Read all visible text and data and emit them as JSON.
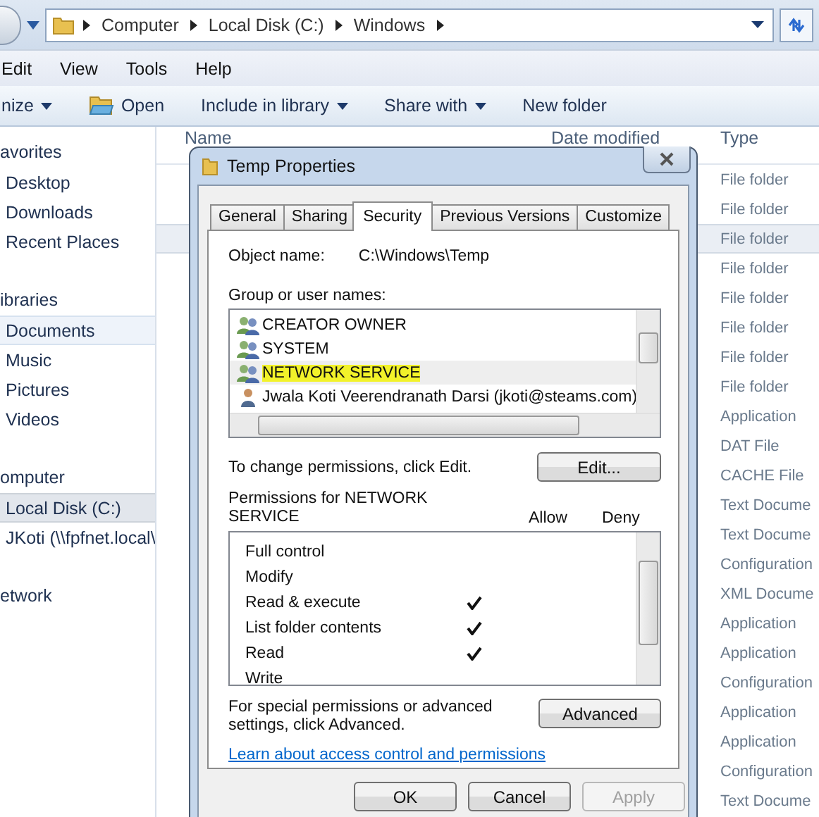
{
  "address_bar": {
    "path": [
      "Computer",
      "Local Disk (C:)",
      "Windows"
    ]
  },
  "menu": [
    "Edit",
    "View",
    "Tools",
    "Help"
  ],
  "toolbar": [
    {
      "label": "nize",
      "kind": "dropdown"
    },
    {
      "label": "Open",
      "kind": "icon"
    },
    {
      "label": "Include in library",
      "kind": "dropdown"
    },
    {
      "label": "Share with",
      "kind": "dropdown"
    },
    {
      "label": "New folder",
      "kind": "plain"
    }
  ],
  "nav": [
    {
      "label": "avorites",
      "items": [
        {
          "label": "Desktop",
          "selected": false,
          "hovered": false
        },
        {
          "label": "Downloads",
          "selected": false,
          "hovered": false
        },
        {
          "label": "Recent Places",
          "selected": false,
          "hovered": false
        }
      ]
    },
    {
      "label": "ibraries",
      "items": [
        {
          "label": "Documents",
          "selected": false,
          "hovered": true
        },
        {
          "label": "Music",
          "selected": false,
          "hovered": false
        },
        {
          "label": "Pictures",
          "selected": false,
          "hovered": false
        },
        {
          "label": "Videos",
          "selected": false,
          "hovered": false
        }
      ]
    },
    {
      "label": "omputer",
      "items": [
        {
          "label": "Local Disk (C:)",
          "selected": true,
          "hovered": false
        },
        {
          "label": "JKoti (\\\\fpfnet.local\\",
          "selected": false,
          "hovered": false
        }
      ]
    },
    {
      "label": "etwork"
    }
  ],
  "file_list": {
    "columns": [
      "Name",
      "Date modified",
      "Type"
    ],
    "rows": [
      {
        "type": "File folder",
        "selected": false
      },
      {
        "type": "File folder",
        "selected": false
      },
      {
        "type": "File folder",
        "selected": true
      },
      {
        "type": "File folder",
        "selected": false
      },
      {
        "type": "File folder",
        "selected": false
      },
      {
        "type": "File folder",
        "selected": false
      },
      {
        "type": "File folder",
        "selected": false
      },
      {
        "type": "File folder",
        "selected": false
      },
      {
        "type": "Application",
        "selected": false
      },
      {
        "type": "DAT File",
        "selected": false
      },
      {
        "type": "CACHE File",
        "selected": false
      },
      {
        "type": "Text Docume",
        "selected": false
      },
      {
        "type": "Text Docume",
        "selected": false
      },
      {
        "type": "Configuration",
        "selected": false
      },
      {
        "type": "XML Docume",
        "selected": false
      },
      {
        "type": "Application",
        "selected": false
      },
      {
        "type": "Application",
        "selected": false
      },
      {
        "type": "Configuration",
        "selected": false
      },
      {
        "type": "Application",
        "selected": false
      },
      {
        "type": "Application",
        "selected": false
      },
      {
        "type": "Configuration",
        "selected": false
      },
      {
        "type": "Text Docume",
        "selected": false
      }
    ]
  },
  "dialog": {
    "title": "Temp Properties",
    "tabs": [
      {
        "label": "General",
        "selected": false
      },
      {
        "label": "Sharing",
        "selected": false
      },
      {
        "label": "Security",
        "selected": true
      },
      {
        "label": "Previous Versions",
        "selected": false
      },
      {
        "label": "Customize",
        "selected": false
      }
    ],
    "object_name_label": "Object name:",
    "object_name": "C:\\Windows\\Temp",
    "users_label": "Group or user names:",
    "users": [
      {
        "name": "CREATOR OWNER",
        "kind": "group",
        "selected": false,
        "highlighted": false
      },
      {
        "name": "SYSTEM",
        "kind": "group",
        "selected": false,
        "highlighted": false
      },
      {
        "name": "NETWORK SERVICE",
        "kind": "group",
        "selected": true,
        "highlighted": true
      },
      {
        "name": "Jwala Koti Veerendranath Darsi (jkoti@steams.com)",
        "kind": "user",
        "selected": false,
        "highlighted": false
      }
    ],
    "change_hint": "To change permissions, click Edit.",
    "edit_button": "Edit...",
    "permissions_label": "Permissions for NETWORK SERVICE",
    "allow_label": "Allow",
    "deny_label": "Deny",
    "permissions": [
      {
        "name": "Full control",
        "allow": false,
        "deny": false
      },
      {
        "name": "Modify",
        "allow": false,
        "deny": false
      },
      {
        "name": "Read & execute",
        "allow": true,
        "deny": false
      },
      {
        "name": "List folder contents",
        "allow": true,
        "deny": false
      },
      {
        "name": "Read",
        "allow": true,
        "deny": false
      },
      {
        "name": "Write",
        "allow": false,
        "deny": false
      }
    ],
    "advanced_hint": "For special permissions or advanced settings, click Advanced.",
    "advanced_button": "Advanced",
    "link": "Learn about access control and permissions",
    "buttons": [
      {
        "label": "OK",
        "disabled": false
      },
      {
        "label": "Cancel",
        "disabled": false
      },
      {
        "label": "Apply",
        "disabled": true
      }
    ]
  }
}
